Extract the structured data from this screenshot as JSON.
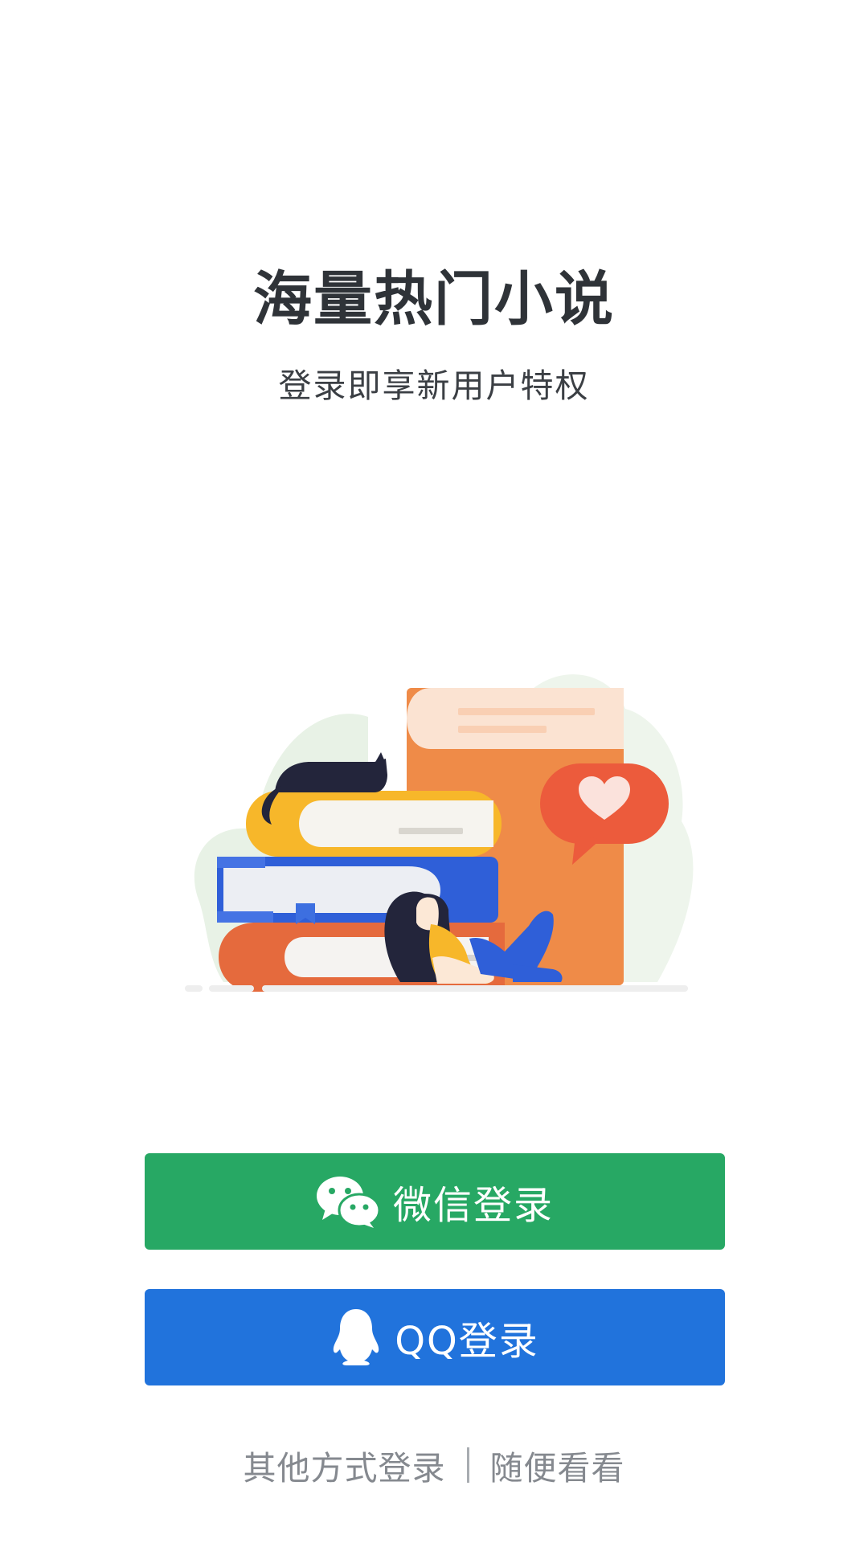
{
  "headline": "海量热门小说",
  "subline": "登录即享新用户特权",
  "buttons": {
    "wechat": {
      "label": "微信登录",
      "icon": "wechat-icon",
      "color": "#27a864"
    },
    "qq": {
      "label": "QQ登录",
      "icon": "qq-penguin-icon",
      "color": "#2173dc"
    }
  },
  "footer": {
    "other_login": "其他方式登录",
    "browse": "随便看看"
  },
  "illustration": {
    "icon": "books-reading-illustration",
    "colors": {
      "orange_book": "#ee8a4e",
      "yellow_book": "#f7b72a",
      "blue_book": "#2f5fd8",
      "bubble": "#ec5b3c"
    }
  }
}
